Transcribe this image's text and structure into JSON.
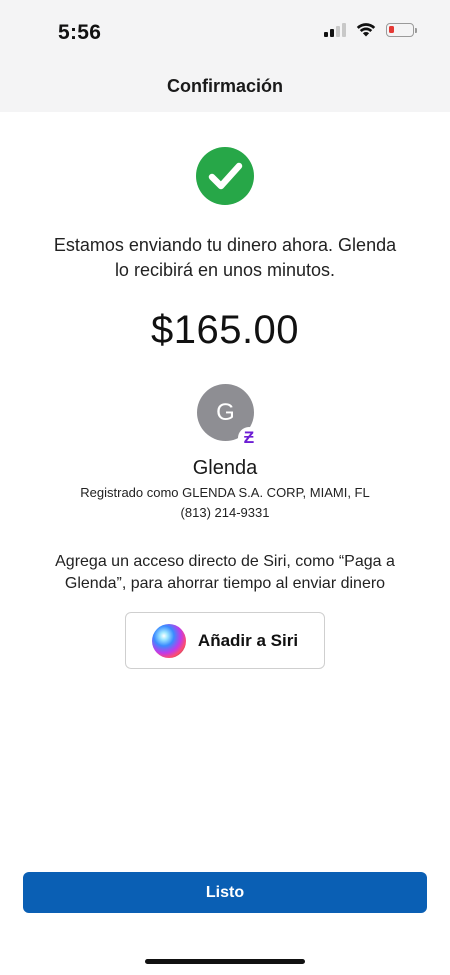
{
  "status_bar": {
    "time": "5:56",
    "icons": [
      "cellular-signal-icon",
      "wifi-icon",
      "battery-low-icon"
    ]
  },
  "nav": {
    "title": "Confirmación"
  },
  "confirmation": {
    "icon": "check-circle-icon",
    "message_line1": "Estamos enviando tu dinero ahora. Glenda",
    "message_line2": "lo recibirá en unos minutos.",
    "amount": "$165.00"
  },
  "recipient": {
    "initial": "G",
    "badge_glyph": "Ƶ",
    "name": "Glenda",
    "registered_as": "Registrado como GLENDA S.A. CORP, MIAMI, FL",
    "phone": "(813) 214-9331"
  },
  "siri": {
    "message_line1": "Agrega un acceso directo de Siri, como “Paga a",
    "message_line2": "Glenda”, para ahorrar tiempo al enviar dinero",
    "button_label": "Añadir a Siri"
  },
  "footer": {
    "done_label": "Listo"
  },
  "colors": {
    "success": "#27a748",
    "primary_button": "#0a5fb4",
    "zelle_purple": "#6d1ed4",
    "battery_low": "#e53935"
  }
}
